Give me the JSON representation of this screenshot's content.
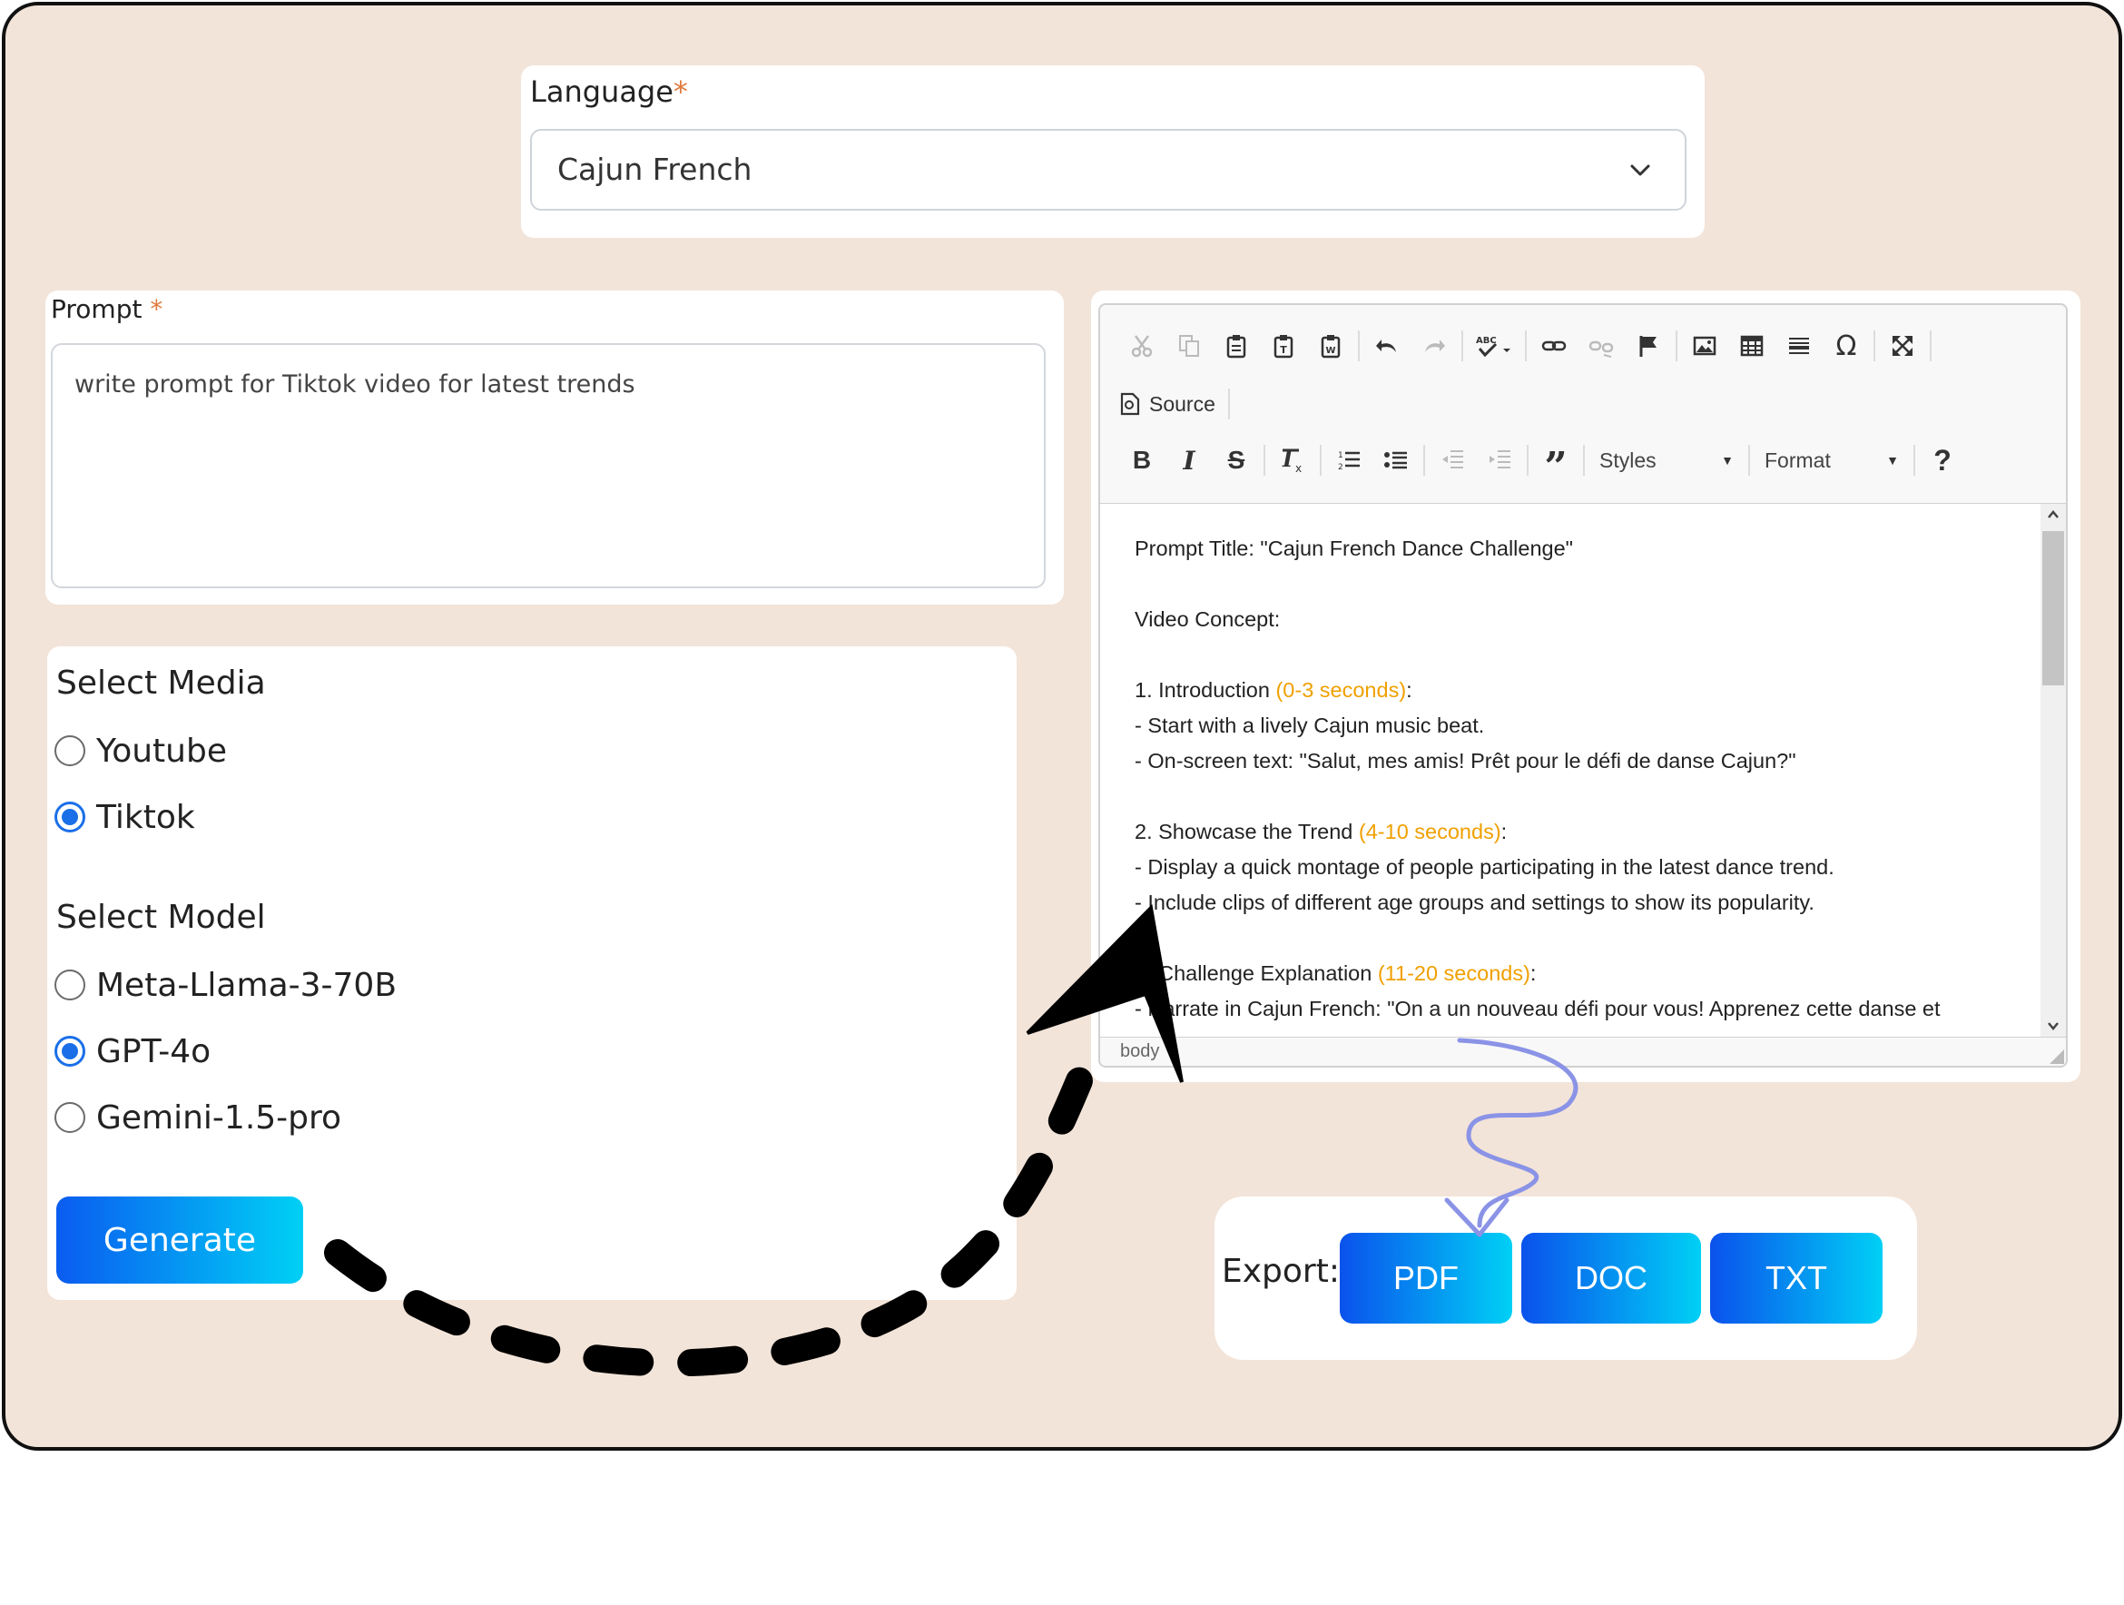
{
  "language": {
    "label": "Language",
    "required_mark": "*",
    "selected": "Cajun French"
  },
  "prompt": {
    "label": "Prompt",
    "required_mark": "*",
    "value": "write prompt for Tiktok video for latest trends"
  },
  "media": {
    "title": "Select Media",
    "options": [
      {
        "label": "Youtube",
        "checked": false
      },
      {
        "label": "Tiktok",
        "checked": true
      }
    ]
  },
  "model": {
    "title": "Select Model",
    "options": [
      {
        "label": "Meta-Llama-3-70B",
        "checked": false
      },
      {
        "label": "GPT-4o",
        "checked": true
      },
      {
        "label": "Gemini-1.5-pro",
        "checked": false
      }
    ]
  },
  "generate_label": "Generate",
  "editor": {
    "source_label": "Source",
    "styles_label": "Styles",
    "format_label": "Format",
    "help_label": "?",
    "status": "body",
    "lines": [
      {
        "text": "Prompt Title: \"Cajun French Dance Challenge\"",
        "hl": ""
      },
      {
        "text": "",
        "hl": ""
      },
      {
        "text": "Video Concept:",
        "hl": ""
      },
      {
        "text": "",
        "hl": ""
      },
      {
        "text": "1. Introduction ",
        "hl": "(0-3 seconds)",
        "after": ":"
      },
      {
        "text": "- Start with a lively Cajun music beat.",
        "hl": ""
      },
      {
        "text": "- On-screen text: \"Salut, mes amis! Prêt pour le défi de danse Cajun?\"",
        "hl": ""
      },
      {
        "text": "",
        "hl": ""
      },
      {
        "text": "2. Showcase the Trend ",
        "hl": "(4-10 seconds)",
        "after": ":"
      },
      {
        "text": "- Display a quick montage of people participating in the latest dance trend.",
        "hl": ""
      },
      {
        "text": "- Include clips of different age groups and settings to show its popularity.",
        "hl": ""
      },
      {
        "text": "",
        "hl": ""
      },
      {
        "text": "3. Challenge Explanation ",
        "hl": "(11-20 seconds)",
        "after": ":"
      },
      {
        "text": "- Narrate in Cajun French: \"On a un nouveau défi pour vous! Apprenez cette danse et",
        "hl": ""
      }
    ]
  },
  "export": {
    "label": "Export:",
    "buttons": [
      "PDF",
      "DOC",
      "TXT"
    ]
  },
  "colors": {
    "background": "#f3e4d9",
    "accent": "#1a6fe8",
    "highlight": "#f0a000",
    "button_gradient": [
      "#0a5cf0",
      "#00d0f5"
    ]
  }
}
